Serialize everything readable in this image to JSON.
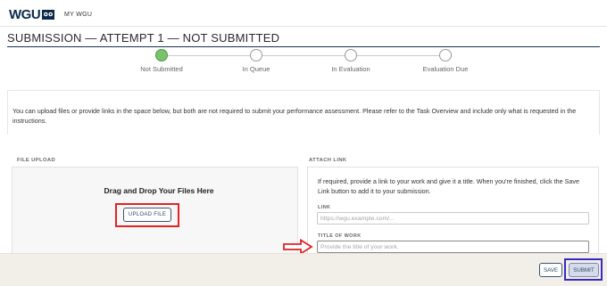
{
  "header": {
    "logo_text": "WGU",
    "nav_link": "MY WGU"
  },
  "page": {
    "title": "SUBMISSION — ATTEMPT 1 — NOT SUBMITTED"
  },
  "stepper": {
    "steps": [
      {
        "label": "Not Submitted",
        "state": "active"
      },
      {
        "label": "In Queue",
        "state": "inactive"
      },
      {
        "label": "In Evaluation",
        "state": "inactive"
      },
      {
        "label": "Evaluation Due",
        "state": "inactive"
      }
    ]
  },
  "info": {
    "text": "You can upload files or provide links in the space below, but both are not required to submit your performance assessment. Please refer to the Task Overview and include only what is requested in the instructions."
  },
  "file_upload": {
    "section_label": "FILE UPLOAD",
    "dropzone_title": "Drag and Drop Your Files Here",
    "upload_button": "UPLOAD FILE"
  },
  "attach_link": {
    "section_label": "ATTACH LINK",
    "description": "If required, provide a link to your work and give it a title. When you're finished, click the Save Link button to add it to your submission.",
    "link_label": "LINK",
    "link_placeholder": "https://wgu.example.com/...",
    "link_value": "",
    "title_label": "TITLE OF WORK",
    "title_placeholder": "Provide the title of your work.",
    "title_value": ""
  },
  "footer": {
    "save_label": "SAVE",
    "submit_label": "SUBMIT"
  },
  "colors": {
    "brand_navy": "#0b2a4a",
    "step_active": "#7ac26e",
    "annotation_red": "#e32222",
    "annotation_blue": "#3a2ac2",
    "footer_bg": "#f2efe9"
  }
}
